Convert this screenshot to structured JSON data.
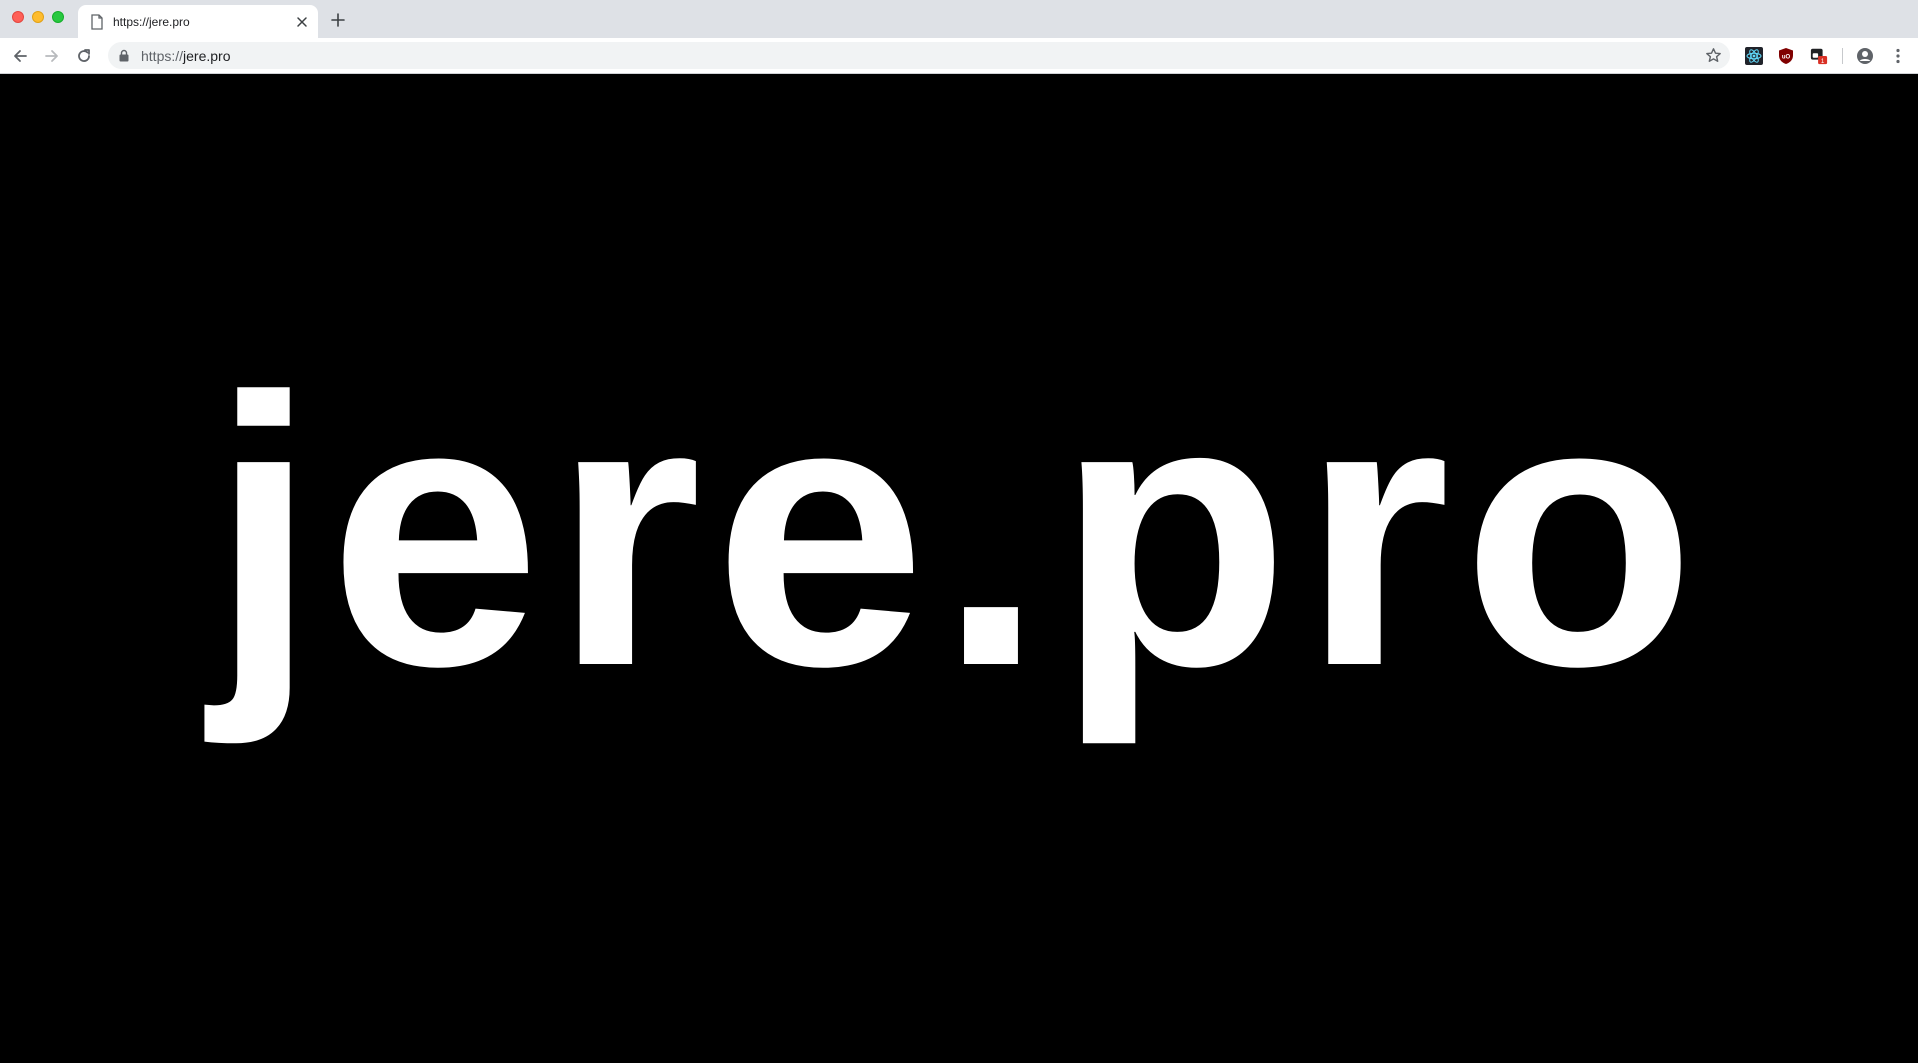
{
  "browser": {
    "tab": {
      "title": "https://jere.pro",
      "favicon_icon": "document-icon",
      "close_icon": "close-icon"
    },
    "new_tab_icon": "plus-icon",
    "toolbar": {
      "back_icon": "arrow-left-icon",
      "forward_icon": "arrow-right-icon",
      "reload_icon": "reload-icon",
      "url_scheme": "https://",
      "url_host": "jere.pro",
      "lock_icon": "lock-icon",
      "bookmark_icon": "star-icon",
      "extensions": [
        "react-devtools-icon",
        "ublock-origin-icon",
        "extension-badge-icon"
      ],
      "extension_badge_text": "1",
      "profile_icon": "account-circle-icon",
      "menu_icon": "kebab-menu-icon"
    }
  },
  "page": {
    "headline": "jere.pro",
    "background_color": "#000000",
    "text_color": "#ffffff"
  },
  "colors": {
    "tabstrip": "#dee1e6",
    "toolbar": "#ffffff",
    "omnibox": "#f1f3f4",
    "close_red": "#fe5f57",
    "minimize_yellow": "#febc2e",
    "zoom_green": "#28c840"
  }
}
